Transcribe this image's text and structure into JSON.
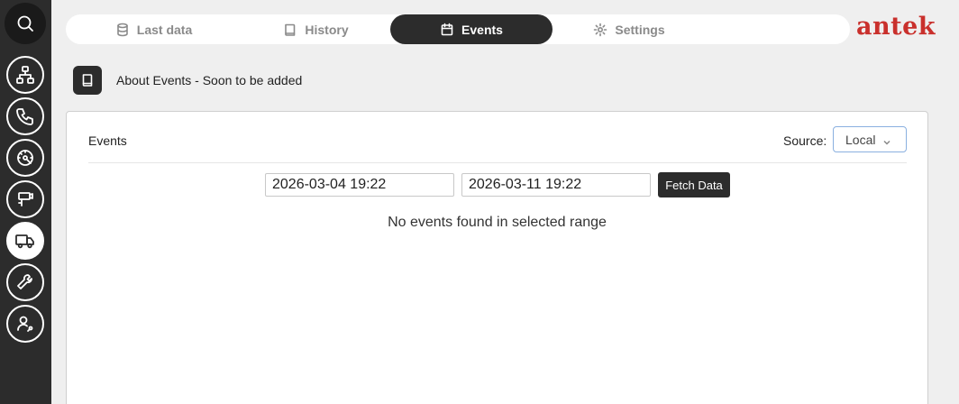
{
  "sidebar": {
    "items": [
      {
        "icon": "search-icon"
      },
      {
        "icon": "network-icon"
      },
      {
        "icon": "phone-icon"
      },
      {
        "icon": "gauge-icon"
      },
      {
        "icon": "camera-icon"
      },
      {
        "icon": "truck-icon",
        "active": true
      },
      {
        "icon": "wrench-icon"
      },
      {
        "icon": "user-settings-icon"
      }
    ]
  },
  "tabs": [
    {
      "label": "Last data",
      "icon": "database-icon"
    },
    {
      "label": "History",
      "icon": "book-icon"
    },
    {
      "label": "Events",
      "icon": "calendar-icon",
      "active": true
    },
    {
      "label": "Settings",
      "icon": "gear-icon"
    }
  ],
  "brand": {
    "logo_text": "antek",
    "color": "#c9302c"
  },
  "about": {
    "text": "About Events - Soon to be added"
  },
  "events_card": {
    "title": "Events",
    "source_label": "Source:",
    "source_value": "Local",
    "date_from": "2026-03-04 19:22",
    "date_to": "2026-03-11 19:22",
    "fetch_label": "Fetch Data",
    "empty_message": "No events found in selected range"
  },
  "colors": {
    "dark": "#2c2c2c",
    "background": "#efefef",
    "accent_border": "#8ab0e0"
  }
}
